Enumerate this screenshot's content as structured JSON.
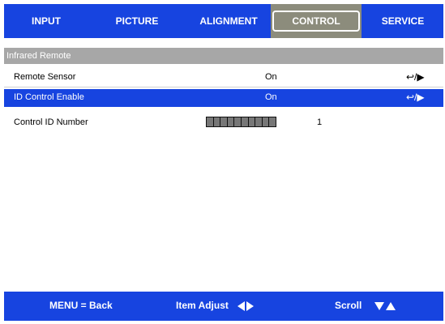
{
  "tabs": [
    {
      "label": "INPUT"
    },
    {
      "label": "PICTURE"
    },
    {
      "label": "ALIGNMENT"
    },
    {
      "label": "CONTROL"
    },
    {
      "label": "SERVICE"
    }
  ],
  "active_tab": "CONTROL",
  "section": {
    "title": "Infrared Remote"
  },
  "rows": [
    {
      "label": "Remote Sensor",
      "value": "On",
      "action_icon": "enter-arrow-icon",
      "action_text": "↩/▶"
    },
    {
      "label": "ID Control Enable",
      "value": "On",
      "action_icon": "enter-arrow-icon",
      "action_text": "↩/▶"
    },
    {
      "label": "Control ID Number",
      "value": "1",
      "slider_level": 0
    }
  ],
  "footer": {
    "back": "MENU = Back",
    "adjust": "Item Adjust",
    "scroll": "Scroll"
  },
  "colors": {
    "accent": "#1744e0",
    "active_tab": "#8c8c7c",
    "section_header": "#a7a7a7"
  }
}
